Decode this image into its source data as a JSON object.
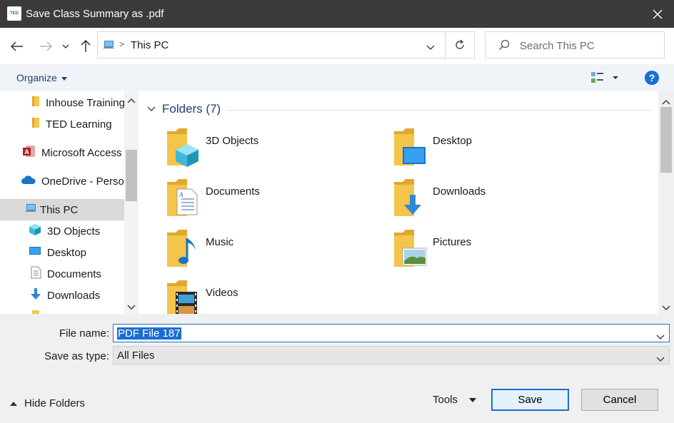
{
  "window": {
    "title": "Save Class Summary as .pdf",
    "app_icon_text": "TED",
    "close_glyph": "✕"
  },
  "nav": {
    "back_icon": "arrow-left-icon",
    "forward_icon": "arrow-right-icon",
    "recent_icon": "chevron-down-icon",
    "up_icon": "arrow-up-icon",
    "address_path": "This PC",
    "search_placeholder": "Search This PC"
  },
  "toolbar": {
    "organize_label": "Organize",
    "help_label": "?"
  },
  "sidebar": {
    "items": [
      {
        "label": "Inhouse Training",
        "icon": "folder-icon"
      },
      {
        "label": "TED Learning",
        "icon": "folder-icon"
      },
      {
        "label": "Microsoft Access",
        "icon": "access-icon"
      },
      {
        "label": "OneDrive - Persor",
        "icon": "onedrive-icon"
      },
      {
        "label": "This PC",
        "icon": "pc-icon",
        "selected": true
      },
      {
        "label": "3D Objects",
        "icon": "cube-icon"
      },
      {
        "label": "Desktop",
        "icon": "desktop-icon"
      },
      {
        "label": "Documents",
        "icon": "document-icon"
      },
      {
        "label": "Downloads",
        "icon": "download-icon"
      }
    ]
  },
  "content": {
    "group_label": "Folders",
    "group_count": "(7)",
    "folders": [
      {
        "label": "3D Objects",
        "icon": "folder-3d-objects-icon"
      },
      {
        "label": "Desktop",
        "icon": "folder-desktop-icon"
      },
      {
        "label": "Documents",
        "icon": "folder-documents-icon"
      },
      {
        "label": "Downloads",
        "icon": "folder-downloads-icon"
      },
      {
        "label": "Music",
        "icon": "folder-music-icon"
      },
      {
        "label": "Pictures",
        "icon": "folder-pictures-icon"
      },
      {
        "label": "Videos",
        "icon": "folder-videos-icon"
      }
    ]
  },
  "form": {
    "file_name_label": "File name:",
    "file_name_value": "PDF File 187",
    "save_type_label": "Save as type:",
    "save_type_value": "All Files"
  },
  "footer": {
    "hide_folders_label": "Hide Folders",
    "tools_label": "Tools",
    "save_label": "Save",
    "cancel_label": "Cancel"
  },
  "colors": {
    "titlebar": "#3b3b3b",
    "accent": "#1b6ed1",
    "link_text": "#1d3f77",
    "folder": "#f3c54a"
  }
}
